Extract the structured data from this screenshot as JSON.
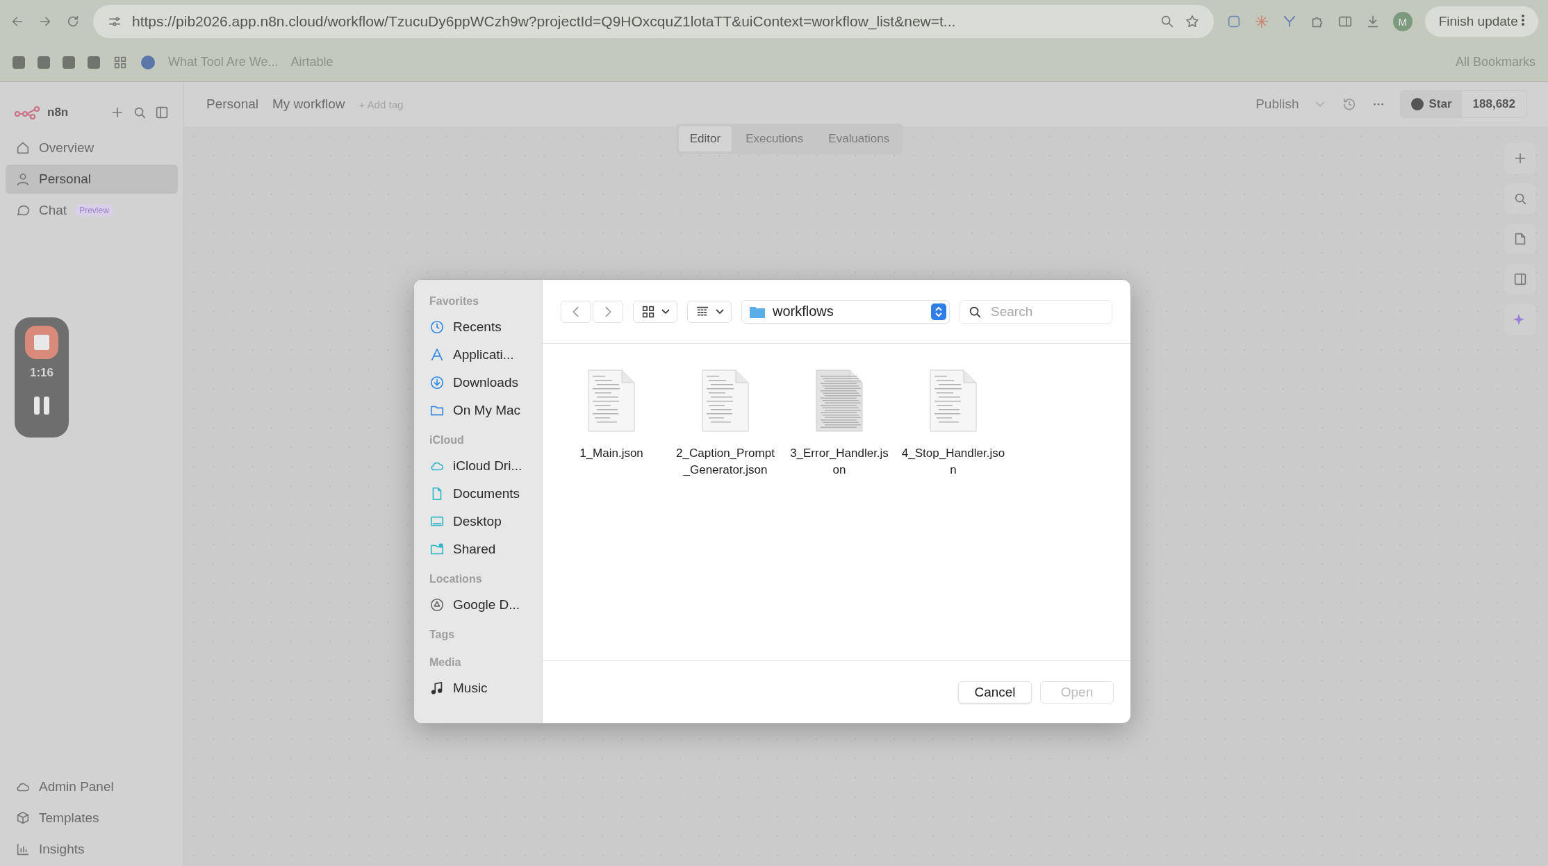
{
  "browser": {
    "url": "https://pib2026.app.n8n.cloud/workflow/TzucuDy6ppWCzh9w?projectId=Q9HOxcquZ1lotaTT&uiContext=workflow_list&new=t...",
    "profile_initial": "M",
    "finish_update": "Finish update",
    "bookmarks": [
      "What Tool Are We...",
      "Airtable"
    ],
    "all_bookmarks": "All Bookmarks"
  },
  "sidebar": {
    "brand": "n8n",
    "items": [
      {
        "label": "Overview",
        "selected": false
      },
      {
        "label": "Personal",
        "selected": true
      },
      {
        "label": "Chat",
        "selected": false,
        "badge": "Preview"
      }
    ],
    "bottom_items": [
      {
        "label": "Admin Panel"
      },
      {
        "label": "Templates"
      },
      {
        "label": "Insights"
      }
    ]
  },
  "header": {
    "project": "Personal",
    "workflow": "My workflow",
    "add_tag": "+ Add tag",
    "publish": "Publish",
    "star": "Star",
    "star_count": "188,682"
  },
  "tabs": [
    {
      "label": "Editor",
      "selected": true
    },
    {
      "label": "Executions",
      "selected": false
    },
    {
      "label": "Evaluations",
      "selected": false
    }
  ],
  "recorder": {
    "time": "1:16"
  },
  "dialog": {
    "sections": [
      {
        "title": "Favorites",
        "items": [
          {
            "label": "Recents"
          },
          {
            "label": "Applicati..."
          },
          {
            "label": "Downloads"
          },
          {
            "label": "On My Mac"
          }
        ]
      },
      {
        "title": "iCloud",
        "items": [
          {
            "label": "iCloud Dri..."
          },
          {
            "label": "Documents"
          },
          {
            "label": "Desktop"
          },
          {
            "label": "Shared"
          }
        ]
      },
      {
        "title": "Locations",
        "items": [
          {
            "label": "Google D..."
          }
        ]
      },
      {
        "title": "Tags"
      },
      {
        "title": "Media",
        "items": [
          {
            "label": "Music"
          }
        ]
      }
    ],
    "location": "workflows",
    "search_placeholder": "Search",
    "files": [
      {
        "name": "1_Main.json",
        "dense": false
      },
      {
        "name": "2_Caption_Prompt_Generator.json",
        "dense": false
      },
      {
        "name": "3_Error_Handler.json",
        "dense": true
      },
      {
        "name": "4_Stop_Handler.json",
        "dense": false
      }
    ],
    "buttons": [
      {
        "label": "Cancel",
        "disabled": false
      },
      {
        "label": "Open",
        "disabled": true
      }
    ]
  }
}
